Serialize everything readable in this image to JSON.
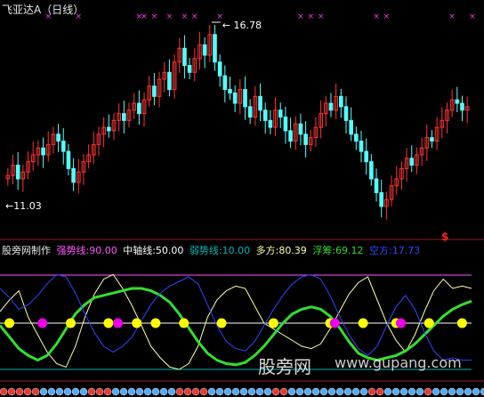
{
  "header": {
    "title": "飞亚达A（日线）"
  },
  "price_chart": {
    "high_label": "16.78",
    "low_label": "11.03",
    "signal_mark": "$",
    "colors": {
      "up": "#ff3333",
      "down": "#54ffff",
      "marker": "#ff33ff",
      "border": "#9b1a1a",
      "signal": "#ff2222"
    }
  },
  "indicator": {
    "legend": {
      "source": "股旁网制作",
      "strong": "强势线:90.00",
      "mid": "中轴线:50.00",
      "weak": "弱势线:10.00",
      "long": "多方:80.39",
      "float": "浮筹:69.12",
      "short": "空方:17.73"
    },
    "colors": {
      "strong": "#ff55ff",
      "mid": "#ffffff",
      "weak": "#00b5b5",
      "long": "#ffffaa",
      "float": "#33dd33",
      "short": "#3344ff",
      "dot_yellow": "#ffff00",
      "dot_magenta": "#ee00ee"
    },
    "watermark": "股旁网",
    "watermark_url": "www.gupang.com"
  },
  "chart_data": [
    {
      "type": "candlestick",
      "title": "飞亚达A（日线）",
      "annotations": [
        {
          "label": "16.78",
          "value": 16.78,
          "kind": "high"
        },
        {
          "label": "11.03",
          "value": 11.03,
          "kind": "low"
        }
      ],
      "closes": [
        12.4,
        12.7,
        12.3,
        12.5,
        12.8,
        13.0,
        13.2,
        13.0,
        13.3,
        13.6,
        13.4,
        13.1,
        12.6,
        12.2,
        12.5,
        12.8,
        13.0,
        13.3,
        13.6,
        13.8,
        13.7,
        14.0,
        14.2,
        14.0,
        14.3,
        14.5,
        14.2,
        14.6,
        15.0,
        14.7,
        15.2,
        15.4,
        14.9,
        15.7,
        16.1,
        15.6,
        15.4,
        15.8,
        16.2,
        15.9,
        16.5,
        15.7,
        15.3,
        14.9,
        14.8,
        14.5,
        14.9,
        14.4,
        14.1,
        14.7,
        14.3,
        14.0,
        13.8,
        14.3,
        14.1,
        13.7,
        13.4,
        13.9,
        13.6,
        13.3,
        13.5,
        13.8,
        14.2,
        14.5,
        14.3,
        14.7,
        14.4,
        14.0,
        13.6,
        13.4,
        13.1,
        12.8,
        12.3,
        11.9,
        11.5,
        11.7,
        12.1,
        12.3,
        12.6,
        12.9,
        12.7,
        13.0,
        13.2,
        13.5,
        13.4,
        13.8,
        14.0,
        14.3,
        14.6,
        14.5,
        14.3,
        14.4
      ]
    },
    {
      "type": "line",
      "title": "",
      "ylim": [
        0,
        100
      ],
      "reference_lines": [
        {
          "name": "强势线",
          "value": 90.0
        },
        {
          "name": "中轴线",
          "value": 50.0
        },
        {
          "name": "弱势线",
          "value": 10.0
        }
      ],
      "series": [
        {
          "name": "多方",
          "last": 80.39,
          "values": [
            60,
            70,
            78,
            55,
            40,
            25,
            15,
            12,
            30,
            55,
            75,
            88,
            92,
            80,
            65,
            48,
            30,
            20,
            12,
            10,
            15,
            30,
            55,
            70,
            78,
            82,
            80,
            65,
            50,
            45,
            40,
            35,
            30,
            28,
            32,
            45,
            60,
            75,
            85,
            90,
            70,
            50,
            35,
            25,
            40,
            60,
            78,
            88,
            80,
            82,
            80
          ]
        },
        {
          "name": "浮筹",
          "last": 69.12,
          "values": [
            48,
            38,
            28,
            22,
            18,
            22,
            32,
            45,
            58,
            66,
            72,
            74,
            76,
            78,
            80,
            80,
            78,
            74,
            68,
            58,
            46,
            34,
            24,
            18,
            15,
            14,
            16,
            22,
            30,
            40,
            50,
            58,
            62,
            64,
            62,
            56,
            46,
            34,
            24,
            20,
            18,
            20,
            22,
            26,
            32,
            40,
            48,
            56,
            62,
            66,
            69
          ]
        },
        {
          "name": "空方",
          "last": 17.73,
          "values": [
            80,
            72,
            62,
            66,
            74,
            84,
            92,
            90,
            76,
            58,
            42,
            30,
            25,
            30,
            38,
            52,
            66,
            76,
            82,
            86,
            90,
            84,
            66,
            48,
            34,
            28,
            26,
            34,
            48,
            62,
            74,
            84,
            90,
            92,
            88,
            74,
            56,
            40,
            28,
            22,
            30,
            48,
            64,
            74,
            62,
            42,
            26,
            18,
            20,
            18,
            18
          ]
        }
      ],
      "dots": {
        "yellow": [
          0.02,
          0.15,
          0.23,
          0.29,
          0.33,
          0.39,
          0.47,
          0.58,
          0.7,
          0.77,
          0.84,
          0.91,
          0.98
        ],
        "magenta": [
          0.09,
          0.25,
          0.71,
          0.85
        ]
      }
    }
  ]
}
